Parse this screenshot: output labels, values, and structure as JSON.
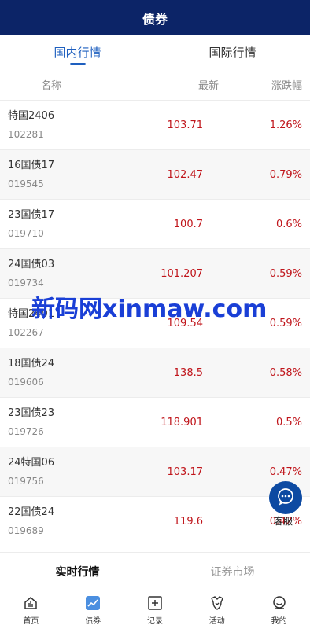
{
  "header": {
    "title": "债券"
  },
  "tabs": [
    {
      "label": "国内行情",
      "active": true
    },
    {
      "label": "国际行情",
      "active": false
    }
  ],
  "columns": {
    "name": "名称",
    "price": "最新",
    "change": "涨跌幅"
  },
  "rows": [
    {
      "name": "特国2406",
      "code": "102281",
      "price": "103.71",
      "change": "1.26%"
    },
    {
      "name": "16国债17",
      "code": "019545",
      "price": "102.47",
      "change": "0.79%"
    },
    {
      "name": "23国债17",
      "code": "019710",
      "price": "100.7",
      "change": "0.6%"
    },
    {
      "name": "24国债03",
      "code": "019734",
      "price": "101.207",
      "change": "0.59%"
    },
    {
      "name": "特国2401",
      "code": "102267",
      "price": "109.54",
      "change": "0.59%"
    },
    {
      "name": "18国债24",
      "code": "019606",
      "price": "138.5",
      "change": "0.58%"
    },
    {
      "name": "23国债23",
      "code": "019726",
      "price": "118.901",
      "change": "0.5%"
    },
    {
      "name": "24特国06",
      "code": "019756",
      "price": "103.17",
      "change": "0.47%"
    },
    {
      "name": "22国债24",
      "code": "019689",
      "price": "119.6",
      "change": "0.42%"
    }
  ],
  "watermark": "新码网xinmaw.com",
  "chat": {
    "label": "客服"
  },
  "subtabs": [
    {
      "label": "实时行情",
      "active": true
    },
    {
      "label": "证券市场",
      "active": false
    }
  ],
  "nav": [
    {
      "label": "首页",
      "icon": "home-icon",
      "active": false
    },
    {
      "label": "债券",
      "icon": "chart-icon",
      "active": true
    },
    {
      "label": "记录",
      "icon": "record-icon",
      "active": false
    },
    {
      "label": "活动",
      "icon": "activity-icon",
      "active": false
    },
    {
      "label": "我的",
      "icon": "profile-icon",
      "active": false
    }
  ],
  "colors": {
    "header_bg": "#0c2467",
    "accent": "#1e5fbf",
    "up_red": "#c0151b"
  }
}
